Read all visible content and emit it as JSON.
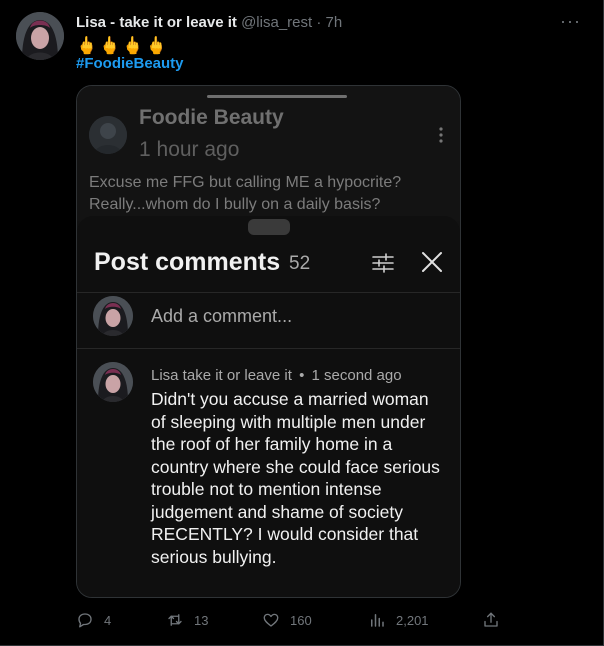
{
  "tweet": {
    "display_name": "Lisa - take it or leave it",
    "handle": "@lisa_rest",
    "dot": "·",
    "time": "7h",
    "more_label": "···",
    "emojis": "🖕🖕🖕🖕",
    "hashtag": "#FoodieBeauty"
  },
  "screenshot": {
    "post_author": "Foodie Beauty",
    "post_time": "1 hour ago",
    "post_text": "Excuse me FFG but calling ME a hypocrite? Really...whom do I bully on a daily basis?",
    "sheet": {
      "title": "Post comments",
      "count": "52",
      "add_placeholder": "Add a comment...",
      "comment": {
        "author": "Lisa take it or leave it",
        "separator": "•",
        "time": "1 second ago",
        "text": "Didn't you accuse a  married woman of sleeping with multiple men under the roof of her family home in a country where she could face serious trouble not to mention intense judgement and shame of society RECENTLY? I would consider that serious bullying."
      }
    }
  },
  "actions": {
    "replies": "4",
    "reposts": "13",
    "likes": "160",
    "views": "2,201"
  },
  "colors": {
    "accent": "#1d9bf0",
    "muted": "#71767b",
    "background": "#000000"
  }
}
